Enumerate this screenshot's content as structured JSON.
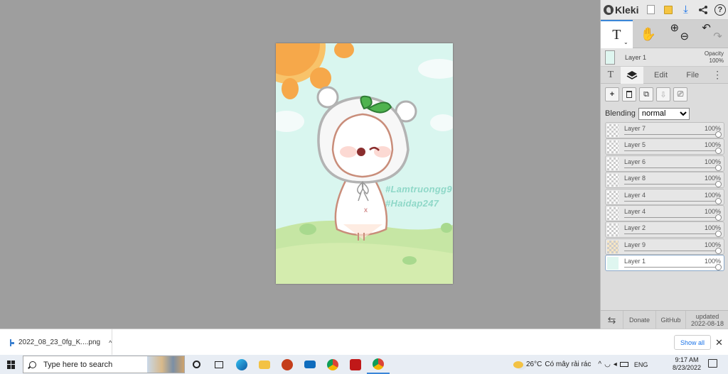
{
  "app": {
    "brand": "Kleki",
    "top_buttons": [
      "new-image-icon",
      "save-icon",
      "download-icon",
      "share-icon",
      "help-icon"
    ],
    "help_glyph": "?",
    "tools": {
      "text_tool": "T",
      "text_caret": "⌄",
      "hand_tool": "✋",
      "zoom_in": "⊕",
      "zoom_out": "⊖",
      "undo": "↶",
      "redo": "↷"
    },
    "current_layer": {
      "name": "Layer 1",
      "opacity_label": "Opacity",
      "opacity_value": "100%"
    },
    "tabs": {
      "text_tab": "T",
      "layers_tab": "layers",
      "edit": "Edit",
      "file": "File",
      "more": "⋮"
    },
    "layer_actions": {
      "add": "+",
      "delete": "🗑",
      "duplicate": "⧉",
      "merge": "⇩",
      "rename": "⎚"
    },
    "blending": {
      "label": "Blending",
      "value": "normal",
      "options": [
        "normal"
      ]
    },
    "layers": [
      {
        "name": "Layer 7",
        "opacity": "100%"
      },
      {
        "name": "Layer 5",
        "opacity": "100%"
      },
      {
        "name": "Layer 6",
        "opacity": "100%"
      },
      {
        "name": "Layer 8",
        "opacity": "100%"
      },
      {
        "name": "Layer 4",
        "opacity": "100%"
      },
      {
        "name": "Layer 4",
        "opacity": "100%"
      },
      {
        "name": "Layer 2",
        "opacity": "100%"
      },
      {
        "name": "Layer 9",
        "opacity": "100%"
      },
      {
        "name": "Layer 1",
        "opacity": "100%"
      }
    ],
    "footer": {
      "swap": "⇆",
      "donate": "Donate",
      "github": "GitHub",
      "updated_line1": "updated",
      "updated_line2": "2022-08-18"
    }
  },
  "artwork": {
    "watermark_1": "#Lamtruongg9",
    "watermark_2": "#Haidap247"
  },
  "download_bar": {
    "file_name": "2022_08_23_0fg_K....png",
    "chevron": "^",
    "show_all": "Show all",
    "close": "✕"
  },
  "taskbar": {
    "search_placeholder": "Type here to search",
    "weather_temp": "26°C",
    "weather_desc": "Có mây rải rác",
    "tray_chevron": "^",
    "language": "ENG",
    "time": "9:17 AM",
    "date": "8/23/2022"
  }
}
